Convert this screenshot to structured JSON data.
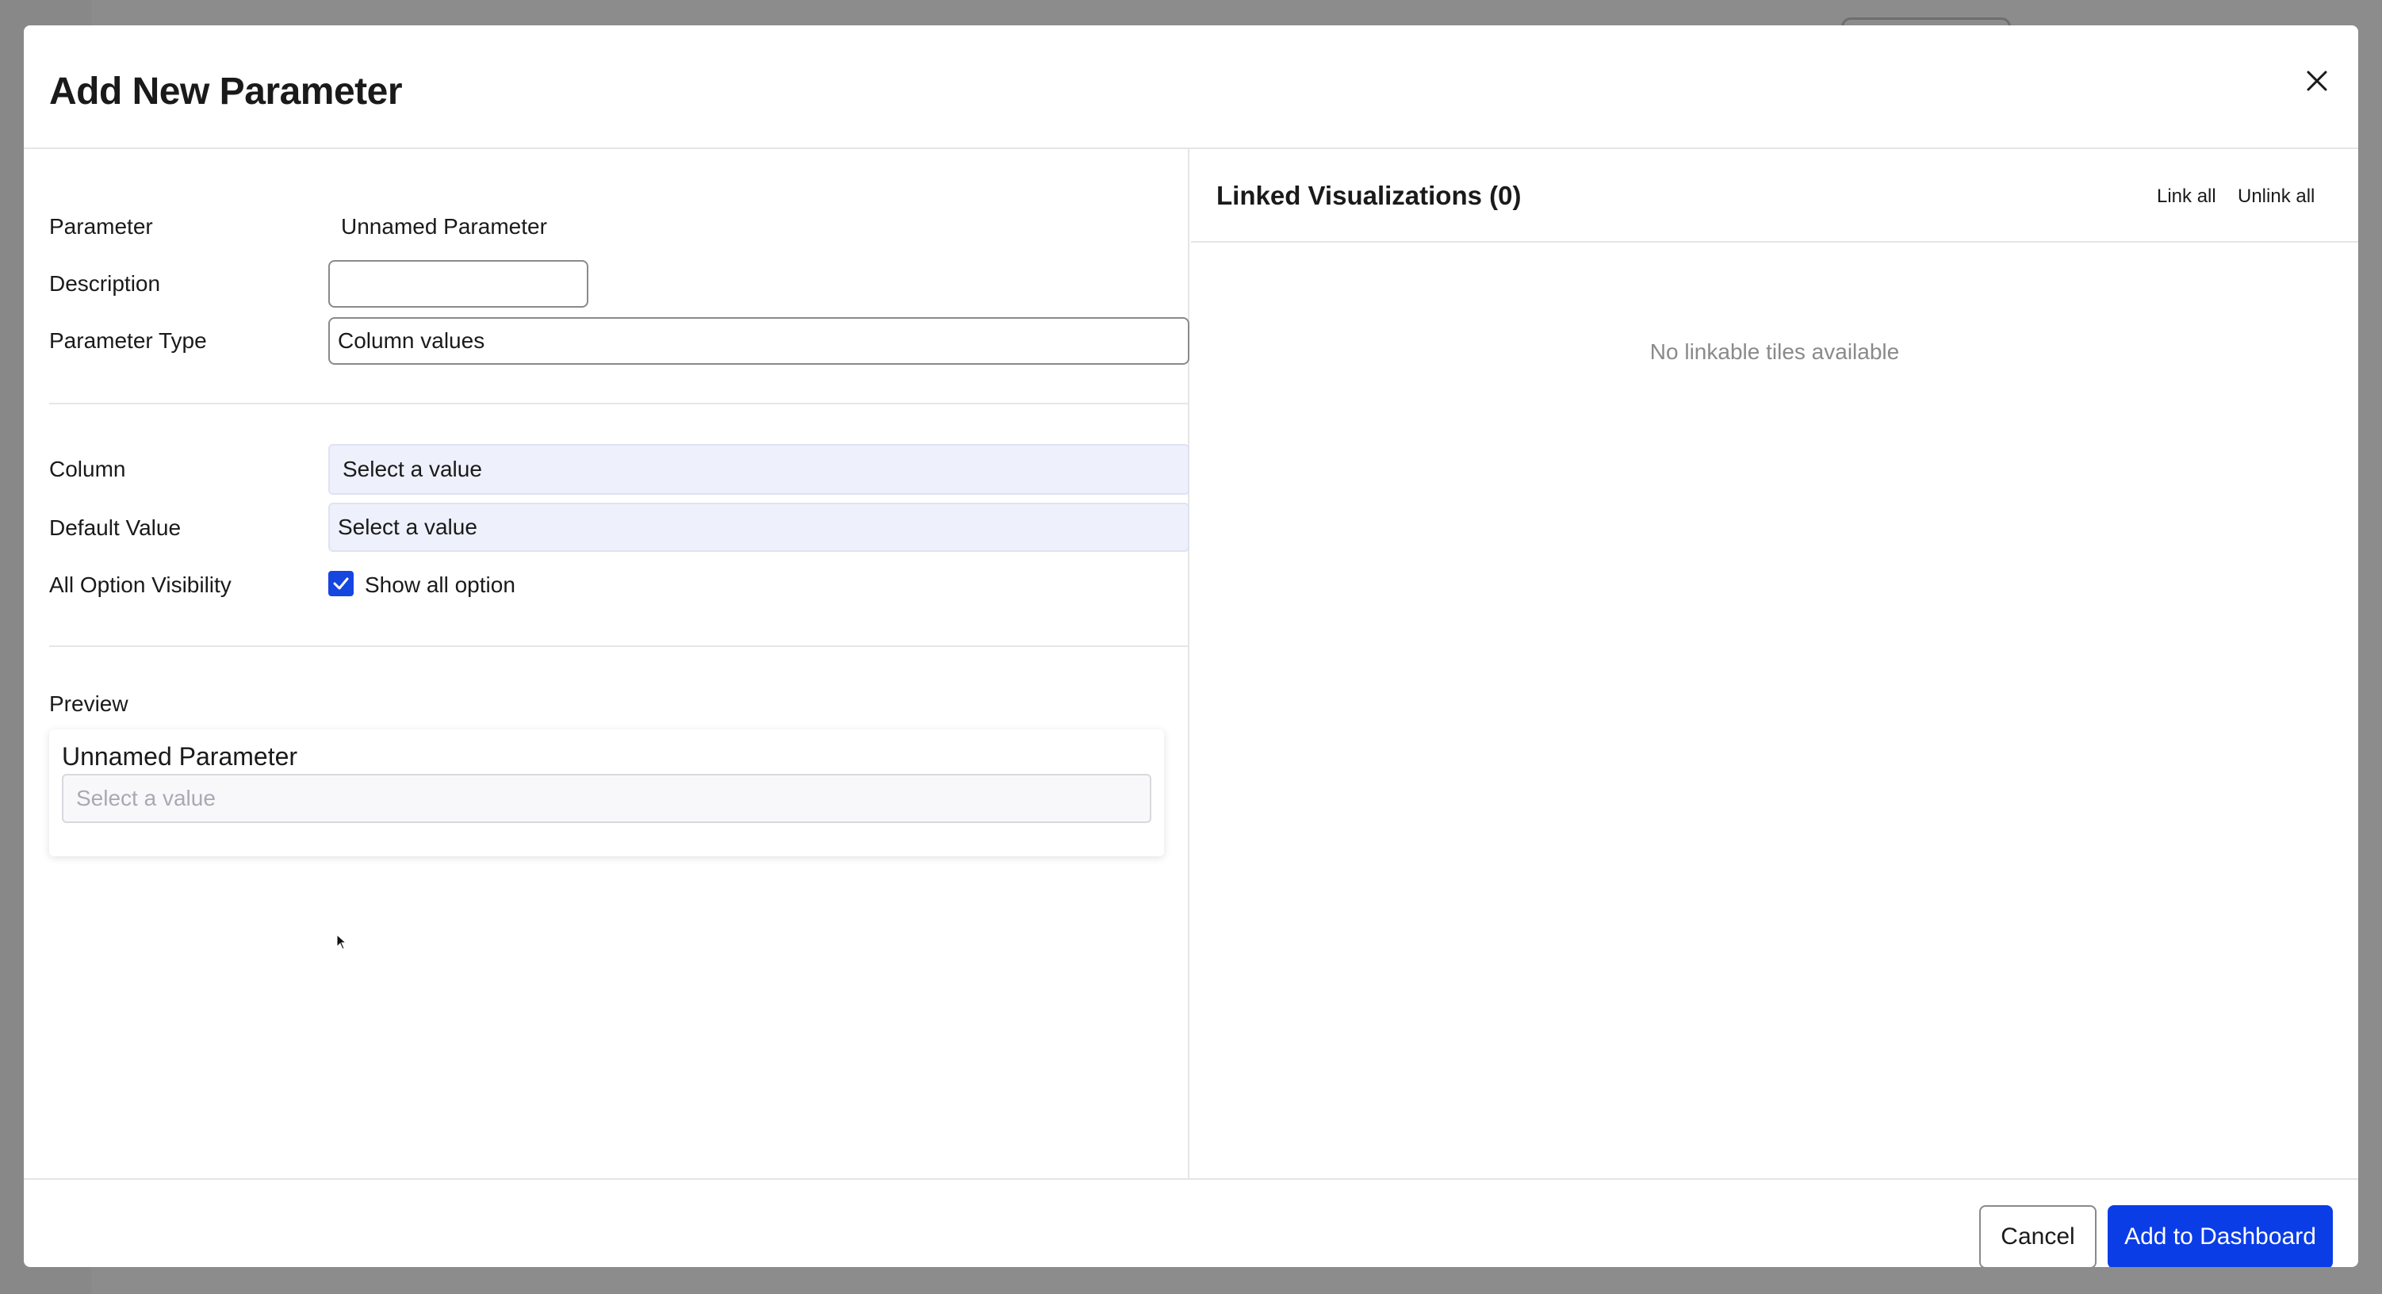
{
  "dialog": {
    "title": "Add New Parameter",
    "close_icon": "close-icon"
  },
  "form": {
    "parameter_label": "Parameter",
    "parameter_value": "Unnamed Parameter",
    "description_label": "Description",
    "description_value": "",
    "parameter_type_label": "Parameter Type",
    "parameter_type_value": "Column values",
    "column_label": "Column",
    "column_value": "Select a value",
    "default_value_label": "Default Value",
    "default_value_value": "Select a value",
    "all_option_label": "All Option Visibility",
    "show_all_option_label": "Show all option",
    "show_all_option_checked": true
  },
  "preview": {
    "label": "Preview",
    "parameter_name": "Unnamed Parameter",
    "placeholder": "Select a value"
  },
  "linked": {
    "title": "Linked Visualizations (0)",
    "link_all": "Link all",
    "unlink_all": "Unlink all",
    "empty_message": "No linkable tiles available"
  },
  "footer": {
    "cancel_label": "Cancel",
    "primary_label": "Add to Dashboard"
  },
  "colors": {
    "accent": "#0b3de6",
    "checkbox": "#1546e0",
    "select_bg": "#eef0fb"
  }
}
